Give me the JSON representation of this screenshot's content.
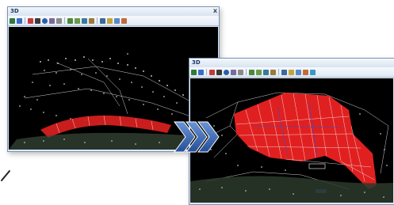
{
  "window_left": {
    "title": "3D",
    "close_glyph": "x"
  },
  "window_right": {
    "title": "3D"
  },
  "toolbar_icons": [
    "rotate-icon",
    "pan-icon",
    "zoom-window-icon",
    "zoom-icon",
    "orbit-icon",
    "view-cube-icon",
    "camera-icon",
    "layer-icon",
    "surface-icon",
    "mesh-icon",
    "settings-icon",
    "light-icon",
    "texture-icon",
    "grid-icon",
    "export-icon",
    "help-icon"
  ],
  "colors": {
    "accent_red": "#e02020",
    "cloud_white": "#f2f2f2",
    "arrow_blue": "#2f63b5",
    "window_frame": "#7a93b3"
  }
}
